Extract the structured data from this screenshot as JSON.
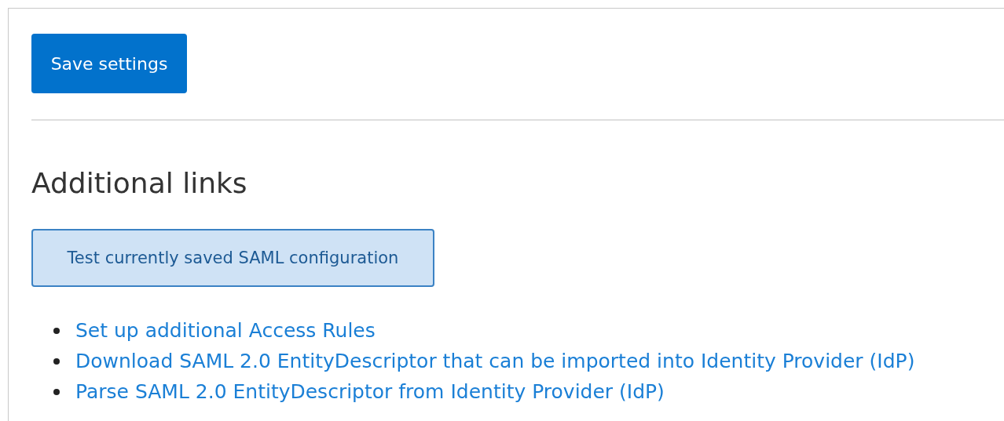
{
  "save_button": {
    "label": "Save settings"
  },
  "section": {
    "heading": "Additional links"
  },
  "test_button": {
    "label": "Test currently saved SAML configuration"
  },
  "links": [
    {
      "label": "Set up additional Access Rules"
    },
    {
      "label": "Download SAML 2.0 EntityDescriptor that can be imported into Identity Provider (IdP)"
    },
    {
      "label": "Parse SAML 2.0 EntityDescriptor from Identity Provider (IdP)"
    }
  ]
}
